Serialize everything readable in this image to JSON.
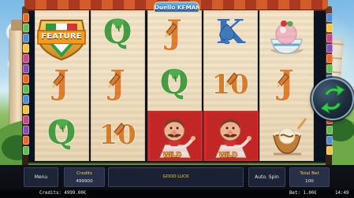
{
  "game": {
    "logo_text": "Duello KEMAN",
    "feature_badge_label": "FEATURE"
  },
  "reels": [
    {
      "rows": [
        {
          "type": "feature-badge",
          "name": "feature-flag-shield"
        },
        {
          "type": "letter",
          "symbol": "J",
          "color": "#df7a28"
        },
        {
          "type": "letter",
          "symbol": "Q",
          "color": "#3f9a3a"
        }
      ]
    },
    {
      "rows": [
        {
          "type": "letter",
          "symbol": "Q",
          "color": "#3f9a3a"
        },
        {
          "type": "letter",
          "symbol": "J",
          "color": "#df7a28"
        },
        {
          "type": "letter",
          "symbol": "10",
          "color": "#d77a22"
        }
      ]
    },
    {
      "rows": [
        {
          "type": "letter",
          "symbol": "J",
          "color": "#df7a28"
        },
        {
          "type": "letter",
          "symbol": "Q",
          "color": "#3f9a3a"
        },
        {
          "type": "wild-chef",
          "label": "WILD"
        }
      ]
    },
    {
      "rows": [
        {
          "type": "letter",
          "symbol": "K",
          "color": "#2f6db7"
        },
        {
          "type": "letter",
          "symbol": "10",
          "color": "#d77a22"
        },
        {
          "type": "wild-chef",
          "label": "WILD"
        }
      ]
    },
    {
      "rows": [
        {
          "type": "ice-cream-bowl",
          "name": "ice-cream-bowl-icon"
        },
        {
          "type": "letter",
          "symbol": "J",
          "color": "#df7a28"
        },
        {
          "type": "coffee-dessert",
          "name": "coffee-dessert-icon"
        }
      ]
    }
  ],
  "controls": {
    "menu_label": "Menu",
    "credits_label": "Credits",
    "credits_value": "499900",
    "message": "GOOD LUCK",
    "auto_spin_label": "Auto. Spin",
    "total_bet_label": "Total Bet",
    "total_bet_value": "100"
  },
  "status_bar": {
    "credits": "Credits: 4999.00€",
    "bet": "Bet: 1.00€",
    "time": "14:49"
  },
  "colors": {
    "spin_button_arrow": "#37c94b",
    "wild_highlight": "#d82a2a",
    "control_bar": "#283047"
  }
}
